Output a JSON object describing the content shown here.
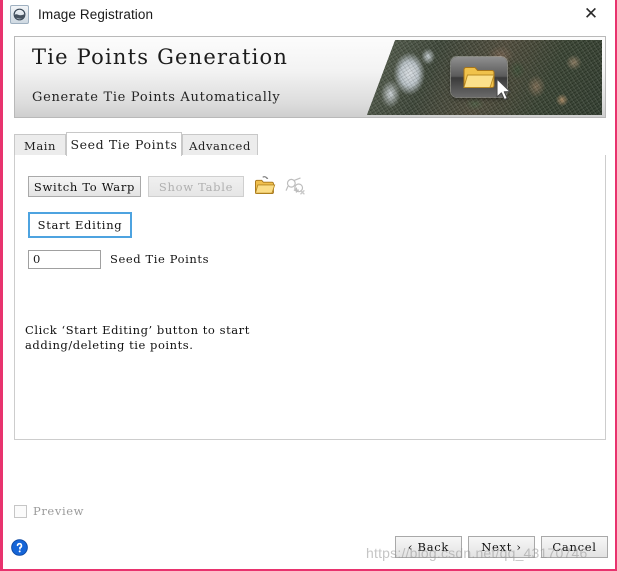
{
  "window": {
    "title": "Image Registration",
    "icon": "app-icon",
    "close_label": "✕",
    "accent_border_color": "#e8336e"
  },
  "banner": {
    "title": "Tie Points Generation",
    "subtitle": "Generate Tie Points Automatically",
    "image": "satellite-imagery",
    "overlay_icon": "folder-icon",
    "cursor_icon": "mouse-cursor-icon"
  },
  "tabs": [
    {
      "label": "Main",
      "active": false
    },
    {
      "label": "Seed Tie Points",
      "active": true
    },
    {
      "label": "Advanced",
      "active": false
    }
  ],
  "panel": {
    "switch_to_warp_label": "Switch To Warp",
    "show_table_label": "Show Table",
    "show_table_enabled": false,
    "start_editing_label": "Start Editing",
    "open_folder_icon": "open-folder-icon",
    "add_points_icon": "add-tie-points-icon",
    "add_points_enabled": false,
    "seed_count_value": "0",
    "seed_count_label": "Seed Tie Points",
    "hint_text": "Click ‘Start Editing’ button to start\nadding/deleting tie points."
  },
  "footer": {
    "preview_label": "Preview",
    "preview_checked": false,
    "help_icon": "help-icon",
    "back_label": "‹ Back",
    "next_label": "Next ›",
    "cancel_label": "Cancel"
  },
  "watermark": {
    "text": "https://blog.csdn.net/qq_43170746"
  }
}
